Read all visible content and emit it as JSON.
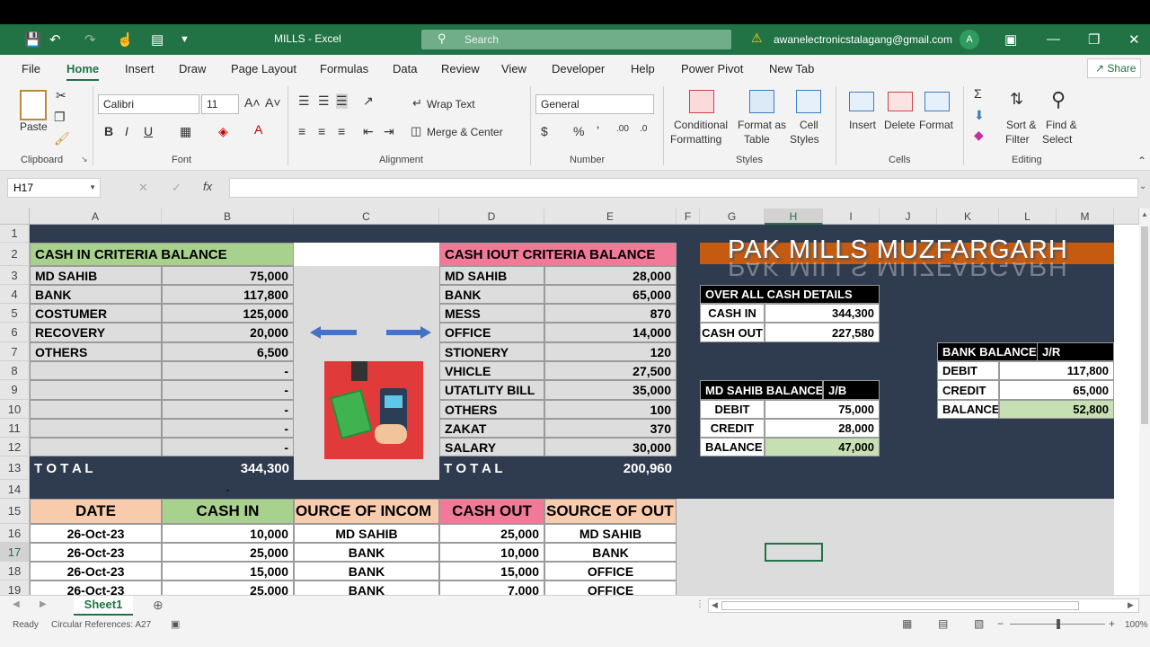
{
  "window": {
    "title": "MILLS  -  Excel",
    "search": "Search",
    "account": "awanelectronicstalagang@gmail.com",
    "avatar": "A"
  },
  "tabs": [
    "File",
    "Home",
    "Insert",
    "Draw",
    "Page Layout",
    "Formulas",
    "Data",
    "Review",
    "View",
    "Developer",
    "Help",
    "Power Pivot",
    "New Tab"
  ],
  "share": "Share",
  "ribbon": {
    "paste": "Paste",
    "clipboard": "Clipboard",
    "font_name": "Calibri",
    "font_size": "11",
    "font": "Font",
    "wrap_text": "Wrap Text",
    "merge_center": "Merge & Center",
    "alignment": "Alignment",
    "number_format": "General",
    "number": "Number",
    "cond_fmt_1": "Conditional",
    "cond_fmt_2": "Formatting",
    "fmt_table_1": "Format as",
    "fmt_table_2": "Table",
    "cell_styles_1": "Cell",
    "cell_styles_2": "Styles",
    "styles": "Styles",
    "insert": "Insert",
    "delete": "Delete",
    "format": "Format",
    "cells": "Cells",
    "sort_1": "Sort &",
    "sort_2": "Filter",
    "find_1": "Find &",
    "find_2": "Select",
    "editing": "Editing"
  },
  "namebox": "H17",
  "fx": "fx",
  "columns": [
    "A",
    "B",
    "C",
    "D",
    "E",
    "F",
    "G",
    "H",
    "I",
    "J",
    "K",
    "L",
    "M"
  ],
  "rows": [
    "1",
    "2",
    "3",
    "4",
    "5",
    "6",
    "7",
    "8",
    "9",
    "10",
    "11",
    "12",
    "13",
    "14",
    "15",
    "16",
    "17",
    "18",
    "19"
  ],
  "cash_in": {
    "title": "CASH IN CRITERIA BALANCE",
    "items": [
      [
        "MD SAHIB",
        "75,000"
      ],
      [
        "BANK",
        "117,800"
      ],
      [
        "COSTUMER",
        "125,000"
      ],
      [
        "RECOVERY",
        "20,000"
      ],
      [
        "OTHERS",
        "6,500"
      ],
      [
        "",
        "-"
      ],
      [
        "",
        "-"
      ],
      [
        "",
        "-"
      ],
      [
        "",
        "-"
      ],
      [
        "",
        "-"
      ]
    ],
    "total_label": "T O T A L",
    "total": "344,300",
    "row14": "-"
  },
  "cash_out": {
    "title": "CASH IOUT CRITERIA BALANCE",
    "items": [
      [
        "MD SAHIB",
        "28,000"
      ],
      [
        "BANK",
        "65,000"
      ],
      [
        "MESS",
        "870"
      ],
      [
        "OFFICE",
        "14,000"
      ],
      [
        "STIONERY",
        "120"
      ],
      [
        "VHICLE",
        "27,500"
      ],
      [
        "UTATLITY BILL",
        "35,000"
      ],
      [
        "OTHERS",
        "100"
      ],
      [
        "ZAKAT",
        "370"
      ],
      [
        "SALARY",
        "30,000"
      ]
    ],
    "total_label": "T O T A L",
    "total": "200,960"
  },
  "banner": "PAK MILLS MUZFARGARH",
  "overall": {
    "title": "OVER ALL CASH DETAILS",
    "rows": [
      [
        "CASH IN",
        "344,300"
      ],
      [
        "CASH OUT",
        "227,580"
      ]
    ]
  },
  "md_sahib": {
    "title": "MD SAHIB BALANCE",
    "tag": "J/B",
    "rows": [
      [
        "DEBIT",
        "75,000"
      ],
      [
        "CREDIT",
        "28,000"
      ],
      [
        "BALANCE",
        "47,000"
      ]
    ]
  },
  "bank": {
    "title": "BANK BALANCE",
    "tag": "J/R",
    "rows": [
      [
        "DEBIT",
        "117,800"
      ],
      [
        "CREDIT",
        "65,000"
      ],
      [
        "BALANCE",
        "52,800"
      ]
    ]
  },
  "ledger": {
    "headers": [
      "DATE",
      "CASH IN",
      "OURCE OF INCOM",
      "CASH OUT",
      "SOURCE OF OUT"
    ],
    "rows": [
      [
        "26-Oct-23",
        "10,000",
        "MD SAHIB",
        "25,000",
        "MD SAHIB"
      ],
      [
        "26-Oct-23",
        "25,000",
        "BANK",
        "10,000",
        "BANK"
      ],
      [
        "26-Oct-23",
        "15,000",
        "BANK",
        "15,000",
        "OFFICE"
      ],
      [
        "26-Oct-23",
        "25,000",
        "BANK",
        "7,000",
        "OFFICE"
      ]
    ]
  },
  "sheet_tab": "Sheet1",
  "status": {
    "ready": "Ready",
    "circ": "Circular References: A27",
    "zoom": "100%"
  }
}
